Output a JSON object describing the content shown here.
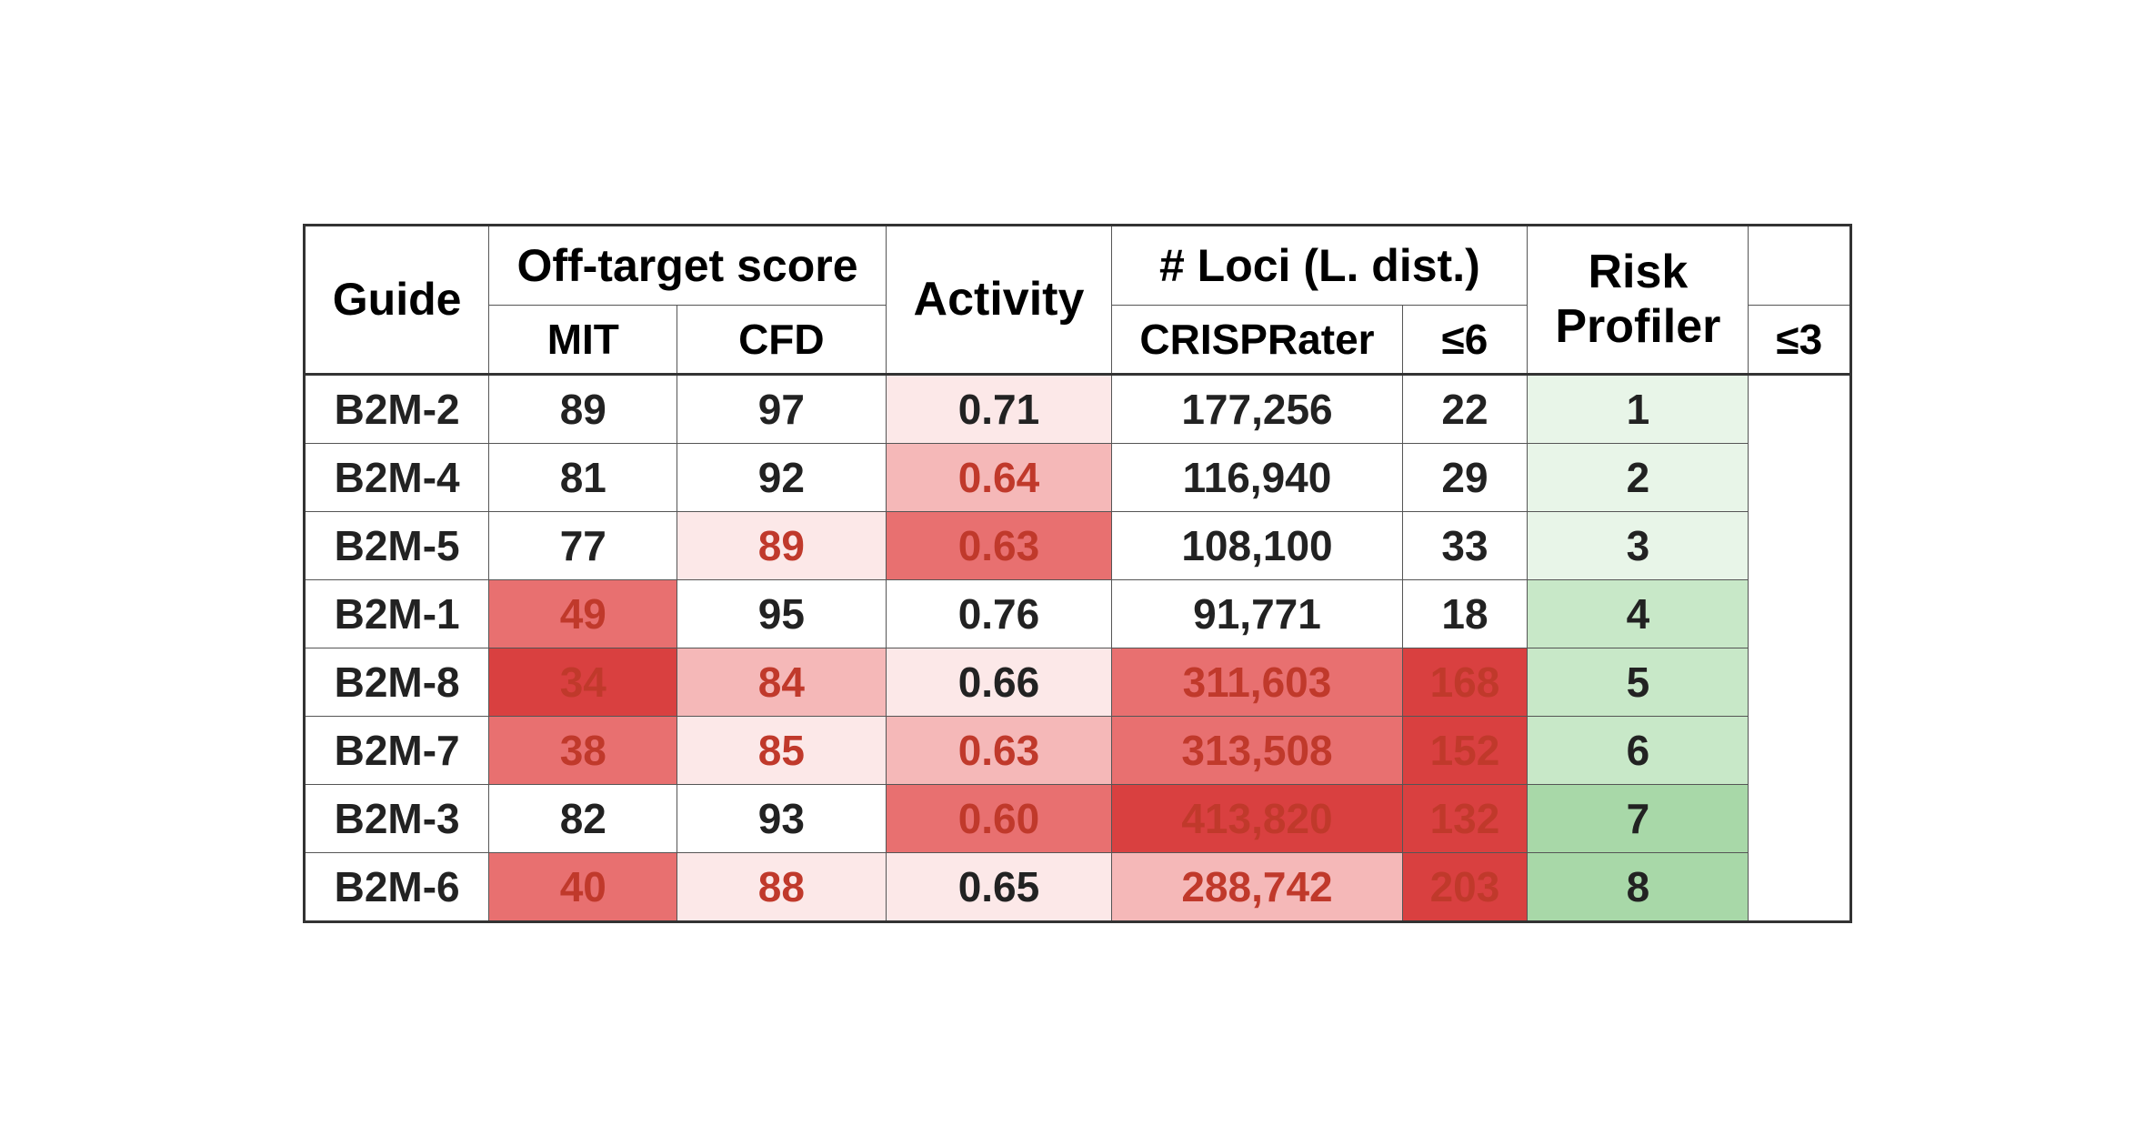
{
  "table": {
    "headers": {
      "col1": "Guide",
      "group1": "Off-target score",
      "group1_sub1": "MIT",
      "group1_sub2": "CFD",
      "group2": "Activity",
      "group2_sub1": "CRISPRater",
      "group3": "# Loci (L. dist.)",
      "group3_sub1": "≤6",
      "group3_sub2": "≤3",
      "group4": "Risk",
      "group4_sub1": "Profiler"
    },
    "rows": [
      {
        "guide": "B2M-2",
        "mit": "89",
        "cfd": "97",
        "crisprater": "0.71",
        "loci6": "177,256",
        "loci3": "22",
        "risk": "1",
        "mit_bg": "bg-white",
        "cfd_bg": "bg-white",
        "crisprater_bg": "bg-pink-light",
        "loci6_bg": "bg-white",
        "loci3_bg": "bg-white",
        "risk_bg": "bg-green-light",
        "mit_text": "text-dark",
        "cfd_text": "text-dark",
        "crisprater_text": "text-dark",
        "loci6_text": "text-dark",
        "loci3_text": "text-dark",
        "risk_text": "text-dark"
      },
      {
        "guide": "B2M-4",
        "mit": "81",
        "cfd": "92",
        "crisprater": "0.64",
        "loci6": "116,940",
        "loci3": "29",
        "risk": "2",
        "mit_bg": "bg-white",
        "cfd_bg": "bg-white",
        "crisprater_bg": "bg-pink-medium",
        "loci6_bg": "bg-white",
        "loci3_bg": "bg-white",
        "risk_bg": "bg-green-light",
        "mit_text": "text-dark",
        "cfd_text": "text-dark",
        "crisprater_text": "text-red",
        "loci6_text": "text-dark",
        "loci3_text": "text-dark",
        "risk_text": "text-dark"
      },
      {
        "guide": "B2M-5",
        "mit": "77",
        "cfd": "89",
        "crisprater": "0.63",
        "loci6": "108,100",
        "loci3": "33",
        "risk": "3",
        "mit_bg": "bg-white",
        "cfd_bg": "bg-pink-light",
        "crisprater_bg": "bg-pink-dark",
        "loci6_bg": "bg-white",
        "loci3_bg": "bg-white",
        "risk_bg": "bg-green-light",
        "mit_text": "text-dark",
        "cfd_text": "text-red",
        "crisprater_text": "text-red",
        "loci6_text": "text-dark",
        "loci3_text": "text-dark",
        "risk_text": "text-dark"
      },
      {
        "guide": "B2M-1",
        "mit": "49",
        "cfd": "95",
        "crisprater": "0.76",
        "loci6": "91,771",
        "loci3": "18",
        "risk": "4",
        "mit_bg": "bg-pink-dark",
        "cfd_bg": "bg-white",
        "crisprater_bg": "bg-white",
        "loci6_bg": "bg-white",
        "loci3_bg": "bg-white",
        "risk_bg": "bg-green-medium",
        "mit_text": "text-red",
        "cfd_text": "text-dark",
        "crisprater_text": "text-dark",
        "loci6_text": "text-dark",
        "loci3_text": "text-dark",
        "risk_text": "text-dark"
      },
      {
        "guide": "B2M-8",
        "mit": "34",
        "cfd": "84",
        "crisprater": "0.66",
        "loci6": "311,603",
        "loci3": "168",
        "risk": "5",
        "mit_bg": "bg-pink-darkest",
        "cfd_bg": "bg-pink-medium",
        "crisprater_bg": "bg-pink-light",
        "loci6_bg": "bg-pink-dark",
        "loci3_bg": "bg-pink-darkest",
        "risk_bg": "bg-green-medium",
        "mit_text": "text-red",
        "cfd_text": "text-red",
        "crisprater_text": "text-dark",
        "loci6_text": "text-red",
        "loci3_text": "text-red",
        "risk_text": "text-dark"
      },
      {
        "guide": "B2M-7",
        "mit": "38",
        "cfd": "85",
        "crisprater": "0.63",
        "loci6": "313,508",
        "loci3": "152",
        "risk": "6",
        "mit_bg": "bg-pink-dark",
        "cfd_bg": "bg-pink-light",
        "crisprater_bg": "bg-pink-medium",
        "loci6_bg": "bg-pink-dark",
        "loci3_bg": "bg-pink-darkest",
        "risk_bg": "bg-green-medium",
        "mit_text": "text-red",
        "cfd_text": "text-red",
        "crisprater_text": "text-red",
        "loci6_text": "text-red",
        "loci3_text": "text-red",
        "risk_text": "text-dark"
      },
      {
        "guide": "B2M-3",
        "mit": "82",
        "cfd": "93",
        "crisprater": "0.60",
        "loci6": "413,820",
        "loci3": "132",
        "risk": "7",
        "mit_bg": "bg-white",
        "cfd_bg": "bg-white",
        "crisprater_bg": "bg-pink-dark",
        "loci6_bg": "bg-pink-darkest",
        "loci3_bg": "bg-pink-darkest",
        "risk_bg": "bg-green-dark",
        "mit_text": "text-dark",
        "cfd_text": "text-dark",
        "crisprater_text": "text-red",
        "loci6_text": "text-red",
        "loci3_text": "text-red",
        "risk_text": "text-dark"
      },
      {
        "guide": "B2M-6",
        "mit": "40",
        "cfd": "88",
        "crisprater": "0.65",
        "loci6": "288,742",
        "loci3": "203",
        "risk": "8",
        "mit_bg": "bg-pink-dark",
        "cfd_bg": "bg-pink-light",
        "crisprater_bg": "bg-pink-light",
        "loci6_bg": "bg-pink-medium",
        "loci3_bg": "bg-pink-darkest",
        "risk_bg": "bg-green-dark",
        "mit_text": "text-red",
        "cfd_text": "text-red",
        "crisprater_text": "text-dark",
        "loci6_text": "text-red",
        "loci3_text": "text-red",
        "risk_text": "text-dark"
      }
    ]
  }
}
